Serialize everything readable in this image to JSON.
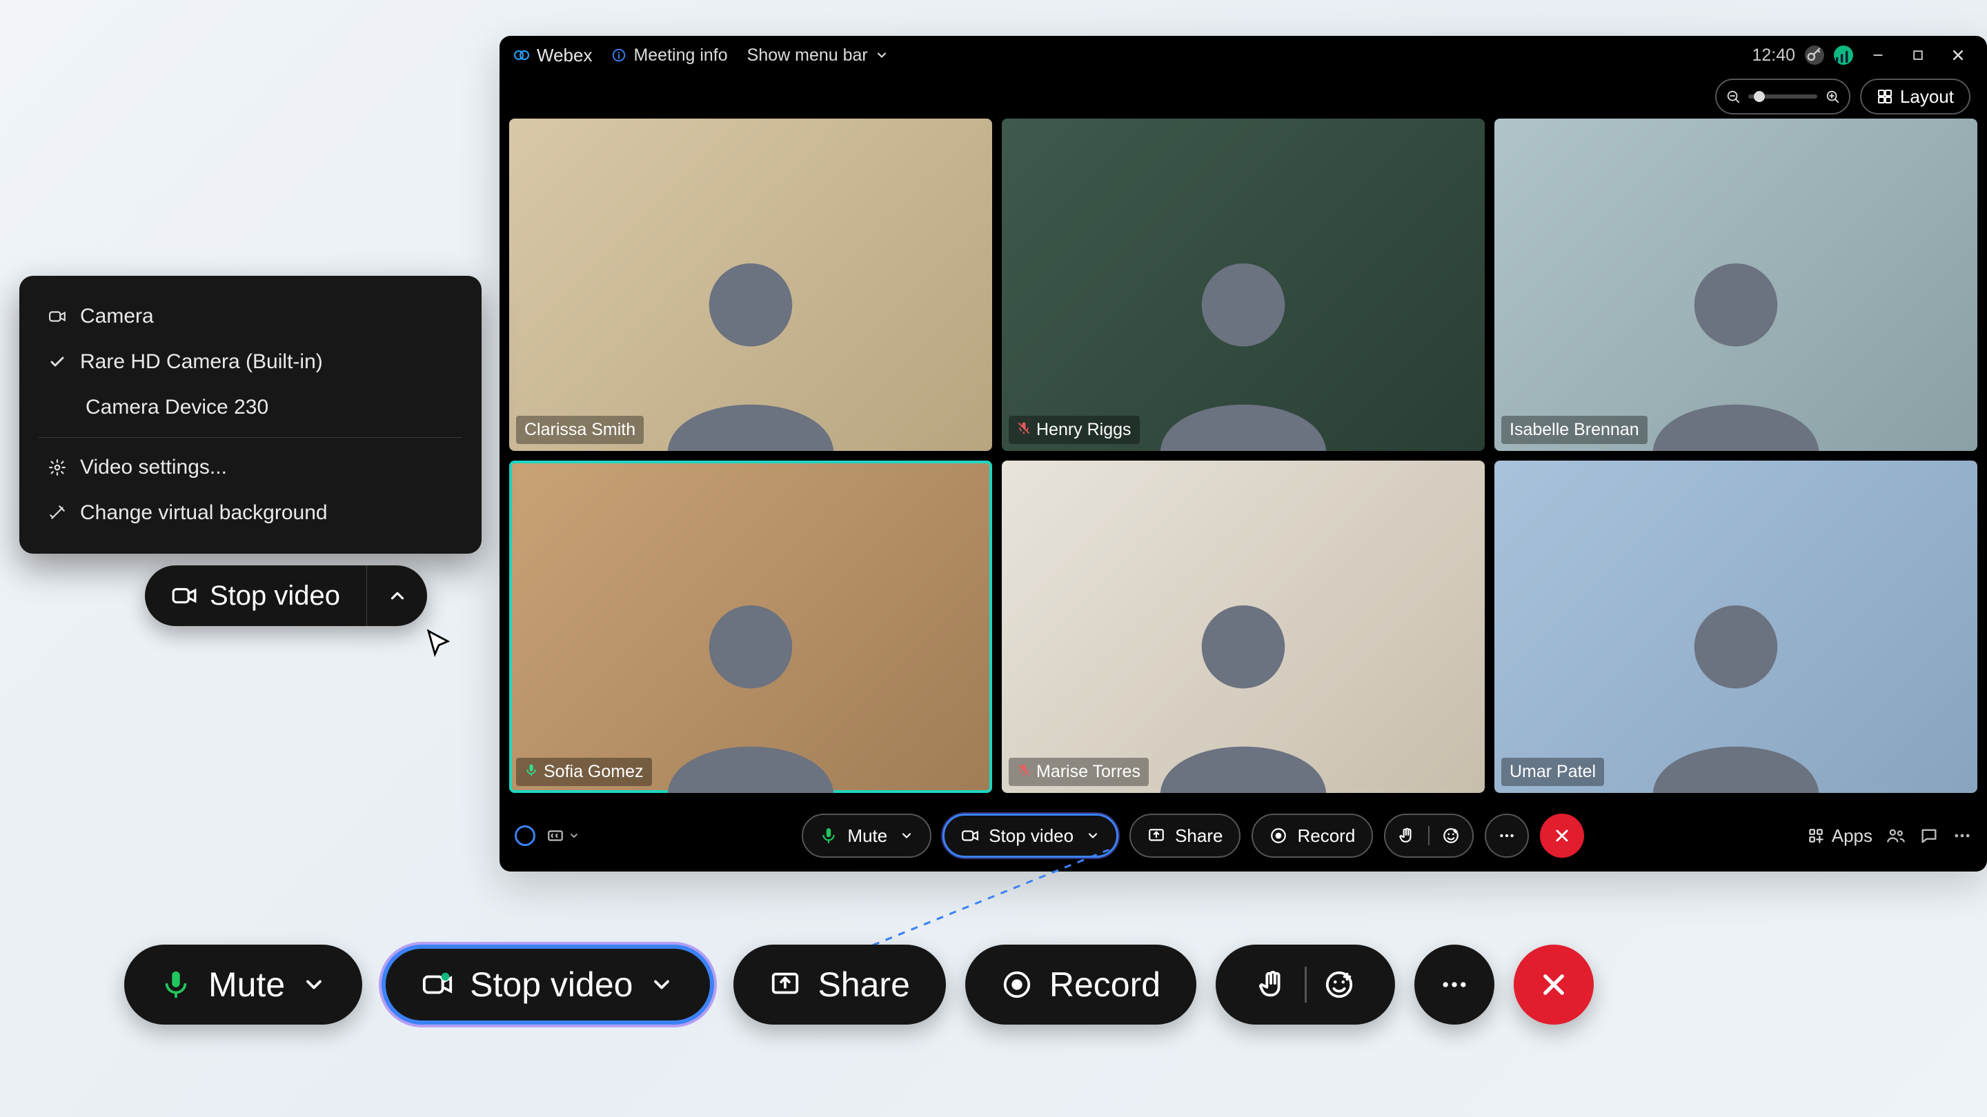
{
  "app": {
    "name": "Webex",
    "meetingInfo": "Meeting info",
    "menuBar": "Show menu bar",
    "time": "12:40"
  },
  "layout": {
    "label": "Layout"
  },
  "participants": [
    {
      "name": "Clarissa Smith",
      "muted": false,
      "showMic": false,
      "active": false,
      "bg": "bg1"
    },
    {
      "name": "Henry Riggs",
      "muted": true,
      "showMic": true,
      "active": false,
      "bg": "bg2"
    },
    {
      "name": "Isabelle Brennan",
      "muted": false,
      "showMic": false,
      "active": false,
      "bg": "bg3"
    },
    {
      "name": "Sofia Gomez",
      "muted": false,
      "showMic": true,
      "active": true,
      "bg": "bg4"
    },
    {
      "name": "Marise Torres",
      "muted": true,
      "showMic": true,
      "active": false,
      "bg": "bg5"
    },
    {
      "name": "Umar Patel",
      "muted": false,
      "showMic": false,
      "active": false,
      "bg": "bg6"
    }
  ],
  "toolbar": {
    "mute": "Mute",
    "stopVideo": "Stop video",
    "share": "Share",
    "record": "Record",
    "apps": "Apps"
  },
  "cameraMenu": {
    "header": "Camera",
    "devices": [
      "Rare HD Camera (Built-in)",
      "Camera Device 230"
    ],
    "settings": "Video settings...",
    "virtualBg": "Change virtual background"
  },
  "bigStopVideo": {
    "label": "Stop video"
  }
}
